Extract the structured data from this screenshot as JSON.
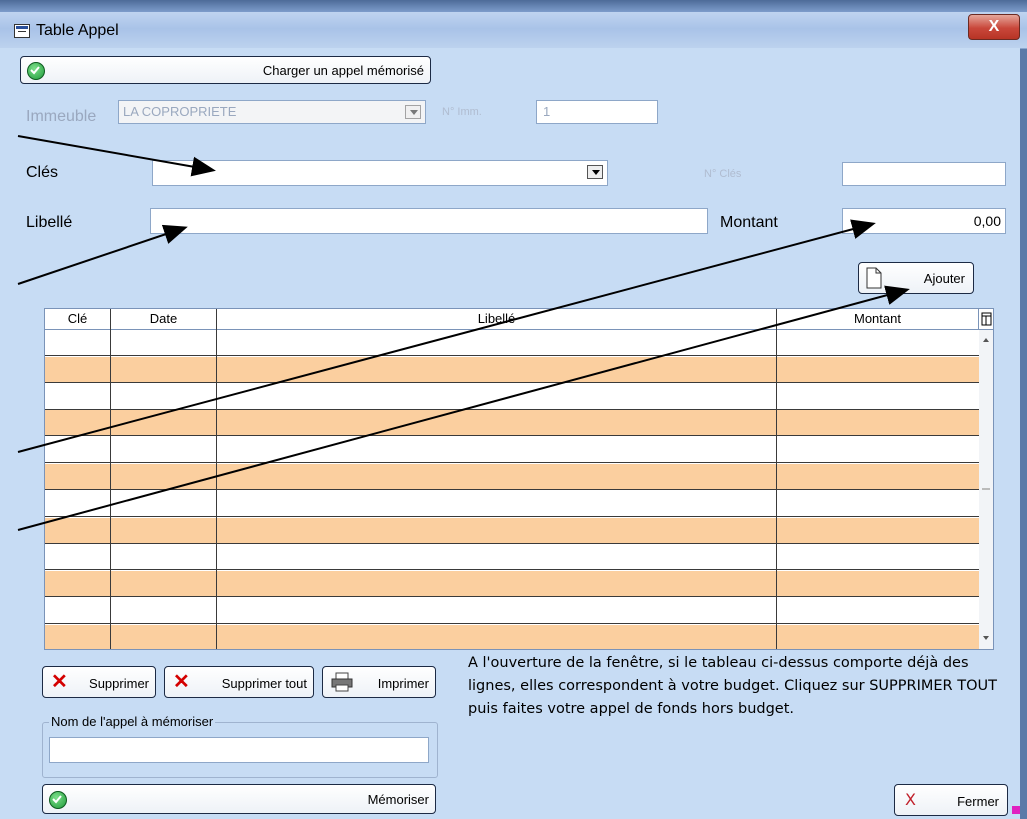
{
  "window": {
    "title": "Table Appel",
    "close_glyph": "X"
  },
  "load_button": {
    "label": "Charger un appel mémorisé",
    "icon": "green-ok-icon"
  },
  "immeuble": {
    "label": "Immeuble",
    "value": "LA COPROPRIETE",
    "num_label": "N° Imm.",
    "num_value": "1"
  },
  "cles": {
    "label": "Clés",
    "value": "",
    "num_label": "N° Clés",
    "num_value": ""
  },
  "libelle": {
    "label": "Libellé",
    "value": ""
  },
  "montant": {
    "label": "Montant",
    "value": "0,00"
  },
  "add_button": {
    "label": "Ajouter",
    "icon": "new-document-icon"
  },
  "table": {
    "columns": [
      "Clé",
      "Date",
      "Libellé",
      "Montant"
    ],
    "row_colors": [
      "#ffffff",
      "#fbcf9f"
    ]
  },
  "actions": {
    "delete_label": "Supprimer",
    "delete_all_label": "Supprimer tout",
    "print_label": "Imprimer"
  },
  "memo": {
    "legend": "Nom de l'appel à mémoriser",
    "value": "",
    "save_label": "Mémoriser"
  },
  "note": "A l'ouverture de la fenêtre, si le tableau ci-dessus comporte déjà des lignes, elles correspondent à votre budget. Cliquez sur SUPPRIMER TOUT puis faites votre appel de fonds hors budget.",
  "close_button": {
    "label": "Fermer"
  },
  "colors": {
    "client_bg": "#c7dcf4",
    "row_alt": "#fbcf9f",
    "accent_green": "#1f9a3a",
    "delete_red": "#d40000"
  }
}
